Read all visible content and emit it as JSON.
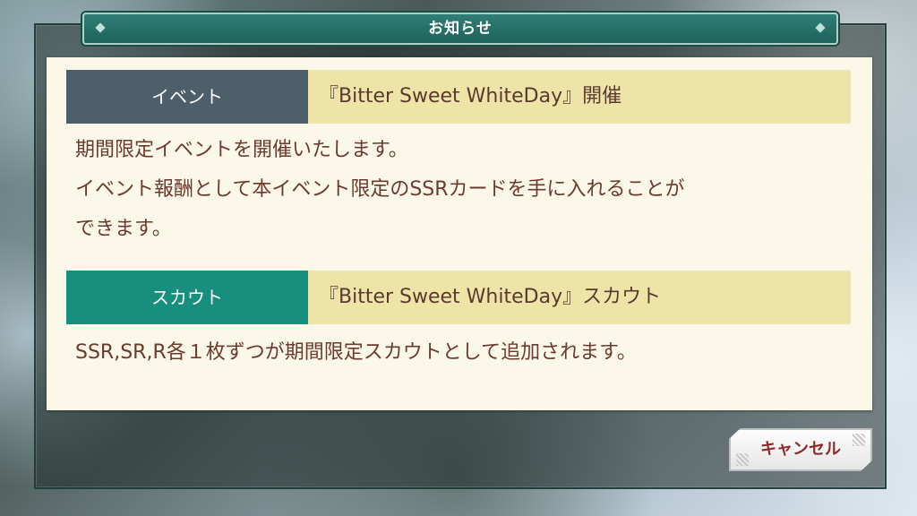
{
  "dialog": {
    "title": "お知らせ"
  },
  "sections": [
    {
      "category": "イベント",
      "heading": "『Bitter Sweet WhiteDay』開催",
      "lines": [
        "期間限定イベントを開催いたします。",
        "イベント報酬として本イベント限定のSSRカードを手に入れることが",
        "できます。"
      ]
    },
    {
      "category": "スカウト",
      "heading": "『Bitter Sweet WhiteDay』スカウト",
      "lines": [
        "SSR,SR,R各１枚ずつが期間限定スカウトとして追加されます。"
      ]
    }
  ],
  "buttons": {
    "cancel_label": "キャンセル"
  },
  "colors": {
    "event_category": "#4c5f6b",
    "scout_category": "#168f7e",
    "heading_bg": "#efe4a8",
    "panel_bg": "#fbf8ea",
    "text": "#6b3a2c",
    "title_bar": "#1f625b"
  }
}
